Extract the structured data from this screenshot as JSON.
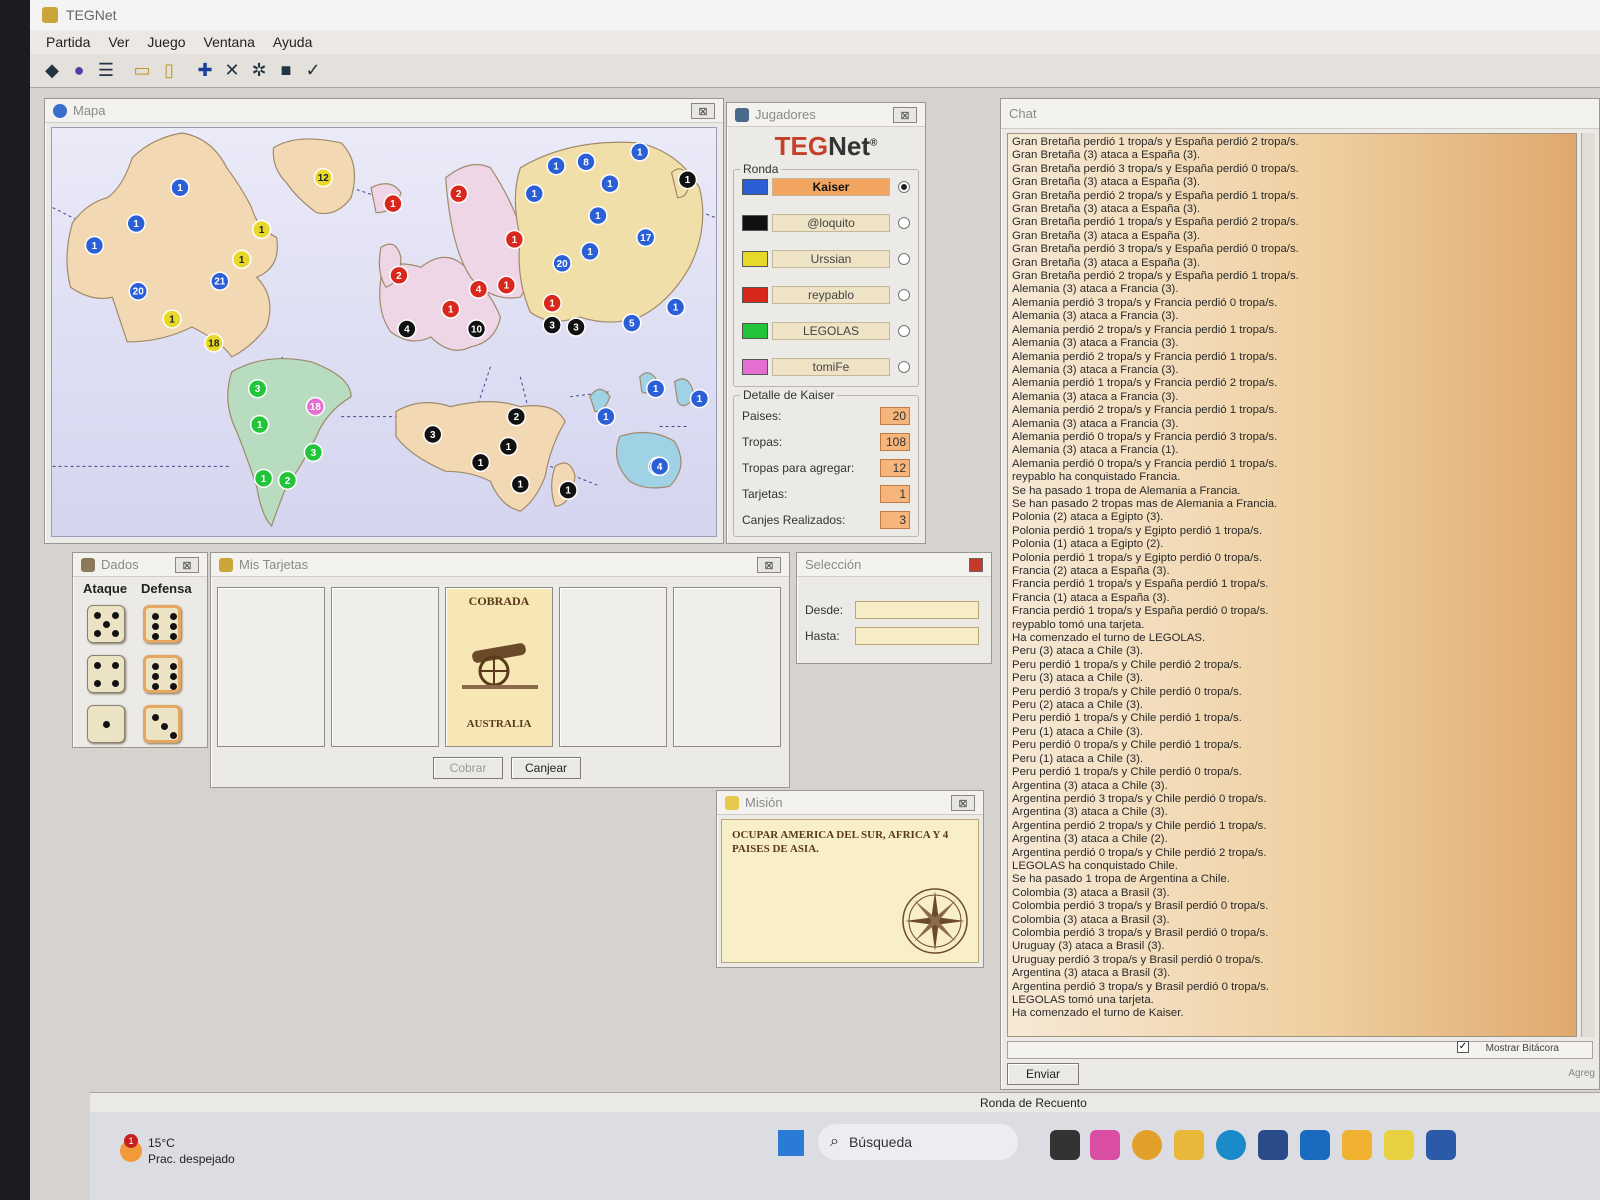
{
  "app": {
    "title": "TEGNet"
  },
  "menu": [
    "Partida",
    "Ver",
    "Juego",
    "Ventana",
    "Ayuda"
  ],
  "windows": {
    "map": "Mapa",
    "players": "Jugadores",
    "dice": "Dados",
    "cards": "Mis Tarjetas",
    "selection": "Selección",
    "mission": "Misión",
    "chat": "Chat"
  },
  "players": {
    "logo_a": "TEG",
    "logo_b": "Net",
    "logo_mark": "®",
    "round_label": "Ronda",
    "list": [
      {
        "name": "Kaiser",
        "color": "#2a5fd6",
        "active": true
      },
      {
        "name": "@loquito",
        "color": "#111111",
        "active": false
      },
      {
        "name": "Urssian",
        "color": "#e8d82a",
        "active": false
      },
      {
        "name": "reypablo",
        "color": "#d8281c",
        "active": false
      },
      {
        "name": "LEGOLAS",
        "color": "#22c43a",
        "active": false
      },
      {
        "name": "tomiFe",
        "color": "#e46ed2",
        "active": false
      }
    ],
    "detail_label": "Detalle de Kaiser",
    "detail": [
      {
        "label": "Paises:",
        "value": "20"
      },
      {
        "label": "Tropas:",
        "value": "108"
      },
      {
        "label": "Tropas para agregar:",
        "value": "12"
      },
      {
        "label": "Tarjetas:",
        "value": "1"
      },
      {
        "label": "Canjes Realizados:",
        "value": "3"
      }
    ]
  },
  "dice": {
    "attack_label": "Ataque",
    "defense_label": "Defensa",
    "attack": [
      5,
      4,
      1
    ],
    "defense": [
      6,
      6,
      3
    ]
  },
  "cards": {
    "status": "COBRADA",
    "country": "AUSTRALIA",
    "cobrar_label": "Cobrar",
    "canjear_label": "Canjear"
  },
  "selection": {
    "from_label": "Desde:",
    "to_label": "Hasta:",
    "from_value": "",
    "to_value": ""
  },
  "mission": {
    "text": "OCUPAR AMERICA DEL SUR, AFRICA Y 4 PAISES DE ASIA."
  },
  "chat": {
    "lines": [
      "Gran Bretaña perdió 1 tropa/s y España perdió 2 tropa/s.",
      "Gran Bretaña (3) ataca a España (3).",
      "Gran Bretaña perdió 3 tropa/s y España perdió 0 tropa/s.",
      "Gran Bretaña (3) ataca a España (3).",
      "Gran Bretaña perdió 2 tropa/s y España perdió 1 tropa/s.",
      "Gran Bretaña (3) ataca a España (3).",
      "Gran Bretaña perdió 1 tropa/s y España perdió 2 tropa/s.",
      "Gran Bretaña (3) ataca a España (3).",
      "Gran Bretaña perdió 3 tropa/s y España perdió 0 tropa/s.",
      "Gran Bretaña (3) ataca a España (3).",
      "Gran Bretaña perdió 2 tropa/s y España perdió 1 tropa/s.",
      "Alemania (3) ataca a Francia (3).",
      "Alemania perdió 3 tropa/s y Francia perdió 0 tropa/s.",
      "Alemania (3) ataca a Francia (3).",
      "Alemania perdió 2 tropa/s y Francia perdió 1 tropa/s.",
      "Alemania (3) ataca a Francia (3).",
      "Alemania perdió 2 tropa/s y Francia perdió 1 tropa/s.",
      "Alemania (3) ataca a Francia (3).",
      "Alemania perdió 1 tropa/s y Francia perdió 2 tropa/s.",
      "Alemania (3) ataca a Francia (3).",
      "Alemania perdió 2 tropa/s y Francia perdió 1 tropa/s.",
      "Alemania (3) ataca a Francia (3).",
      "Alemania perdió 0 tropa/s y Francia perdió 3 tropa/s.",
      "Alemania (3) ataca a Francia (1).",
      "Alemania perdió 0 tropa/s y Francia perdió 1 tropa/s.",
      "reypablo ha conquistado Francia.",
      "Se ha pasado 1 tropa de Alemania a Francia.",
      "Se han pasado 2 tropas mas de Alemania a Francia.",
      "Polonia (2) ataca a Egipto (3).",
      "Polonia perdió 1 tropa/s y Egipto perdió 1 tropa/s.",
      "Polonia (1) ataca a Egipto (2).",
      "Polonia perdió 1 tropa/s y Egipto perdió 0 tropa/s.",
      "Francia (2) ataca a España (3).",
      "Francia perdió 1 tropa/s y España perdió 1 tropa/s.",
      "Francia (1) ataca a España (3).",
      "Francia perdió 1 tropa/s y España perdió 0 tropa/s.",
      "reypablo tomó una tarjeta.",
      "Ha comenzado el turno de LEGOLAS.",
      "Peru (3) ataca a Chile (3).",
      "Peru perdió 1 tropa/s y Chile perdió 2 tropa/s.",
      "Peru (3) ataca a Chile (3).",
      "Peru perdió 3 tropa/s y Chile perdió 0 tropa/s.",
      "Peru (2) ataca a Chile (3).",
      "Peru perdió 1 tropa/s y Chile perdió 1 tropa/s.",
      "Peru (1) ataca a Chile (3).",
      "Peru perdió 0 tropa/s y Chile perdió 1 tropa/s.",
      "Peru (1) ataca a Chile (3).",
      "Peru perdió 1 tropa/s y Chile perdió 0 tropa/s.",
      "Argentina (3) ataca a Chile (3).",
      "Argentina perdió 3 tropa/s y Chile perdió 0 tropa/s.",
      "Argentina (3) ataca a Chile (3).",
      "Argentina perdió 2 tropa/s y Chile perdió 1 tropa/s.",
      "Argentina (3) ataca a Chile (2).",
      "Argentina perdió 0 tropa/s y Chile perdió 2 tropa/s.",
      "LEGOLAS ha conquistado Chile.",
      "Se ha pasado 1 tropa de Argentina a Chile.",
      "Colombia (3) ataca a Brasil (3).",
      "Colombia perdió 3 tropa/s y Brasil perdió 0 tropa/s.",
      "Colombia (3) ataca a Brasil (3).",
      "Colombia perdió 3 tropa/s y Brasil perdió 0 tropa/s.",
      "Uruguay (3) ataca a Brasil (3).",
      "Uruguay perdió 3 tropa/s y Brasil perdió 0 tropa/s.",
      "Argentina (3) ataca a Brasil (3).",
      "Argentina perdió 3 tropa/s y Brasil perdió 0 tropa/s.",
      "LEGOLAS tomó una tarjeta.",
      "Ha comenzado el turno de Kaiser."
    ],
    "send_label": "Enviar",
    "show_log_label": "Mostrar Bitácora",
    "add_label": "Agreg"
  },
  "status": {
    "text": "Ronda de Recuento"
  },
  "taskbar": {
    "search_label": "Búsqueda",
    "weather_temp": "15°C",
    "weather_desc": "Prac. despejado",
    "weather_badge": "1"
  },
  "map_tokens": [
    {
      "owner": "Kaiser",
      "troops": 1
    },
    {
      "owner": "Kaiser",
      "troops": 1
    },
    {
      "owner": "Kaiser",
      "troops": 1
    },
    {
      "owner": "Kaiser",
      "troops": 20
    },
    {
      "owner": "Urssian",
      "troops": 12
    },
    {
      "owner": "Urssian",
      "troops": 1
    },
    {
      "owner": "Urssian",
      "troops": 1
    },
    {
      "owner": "Kaiser",
      "troops": 21
    },
    {
      "owner": "Urssian",
      "troops": 1
    },
    {
      "owner": "Urssian",
      "troops": 18
    },
    {
      "owner": "LEGOLAS",
      "troops": 3
    },
    {
      "owner": "tomiFe",
      "troops": 18
    },
    {
      "owner": "LEGOLAS",
      "troops": 1
    },
    {
      "owner": "LEGOLAS",
      "troops": 3
    },
    {
      "owner": "LEGOLAS",
      "troops": 1
    },
    {
      "owner": "LEGOLAS",
      "troops": 2
    },
    {
      "owner": "reypablo",
      "troops": 1
    },
    {
      "owner": "reypablo",
      "troops": 2
    },
    {
      "owner": "reypablo",
      "troops": 2
    },
    {
      "owner": "@loquito",
      "troops": 4
    },
    {
      "owner": "reypablo",
      "troops": 1
    },
    {
      "owner": "@loquito",
      "troops": 10
    },
    {
      "owner": "reypablo",
      "troops": 4
    },
    {
      "owner": "reypablo",
      "troops": 1
    },
    {
      "owner": "reypablo",
      "troops": 1
    },
    {
      "owner": "Kaiser",
      "troops": 20
    },
    {
      "owner": "reypablo",
      "troops": 1
    },
    {
      "owner": "@loquito",
      "troops": 3
    },
    {
      "owner": "@loquito",
      "troops": 3
    },
    {
      "owner": "Kaiser",
      "troops": 1
    },
    {
      "owner": "Kaiser",
      "troops": 1
    },
    {
      "owner": "Kaiser",
      "troops": 8
    },
    {
      "owner": "Kaiser",
      "troops": 1
    },
    {
      "owner": "Kaiser",
      "troops": 1
    },
    {
      "owner": "@loquito",
      "troops": 1
    },
    {
      "owner": "Kaiser",
      "troops": 1
    },
    {
      "owner": "Kaiser",
      "troops": 17
    },
    {
      "owner": "Kaiser",
      "troops": 1
    },
    {
      "owner": "Kaiser",
      "troops": 1
    },
    {
      "owner": "Kaiser",
      "troops": 5
    },
    {
      "owner": "Kaiser",
      "troops": 1
    },
    {
      "owner": "@loquito",
      "troops": 3
    },
    {
      "owner": "@loquito",
      "troops": 2
    },
    {
      "owner": "@loquito",
      "troops": 1
    },
    {
      "owner": "@loquito",
      "troops": 1
    },
    {
      "owner": "@loquito",
      "troops": 1
    },
    {
      "owner": "@loquito",
      "troops": 1
    },
    {
      "owner": "Kaiser",
      "troops": 1
    },
    {
      "owner": "Kaiser",
      "troops": 1
    },
    {
      "owner": "Kaiser",
      "troops": 1
    },
    {
      "owner": "Kaiser",
      "troops": 4
    }
  ]
}
